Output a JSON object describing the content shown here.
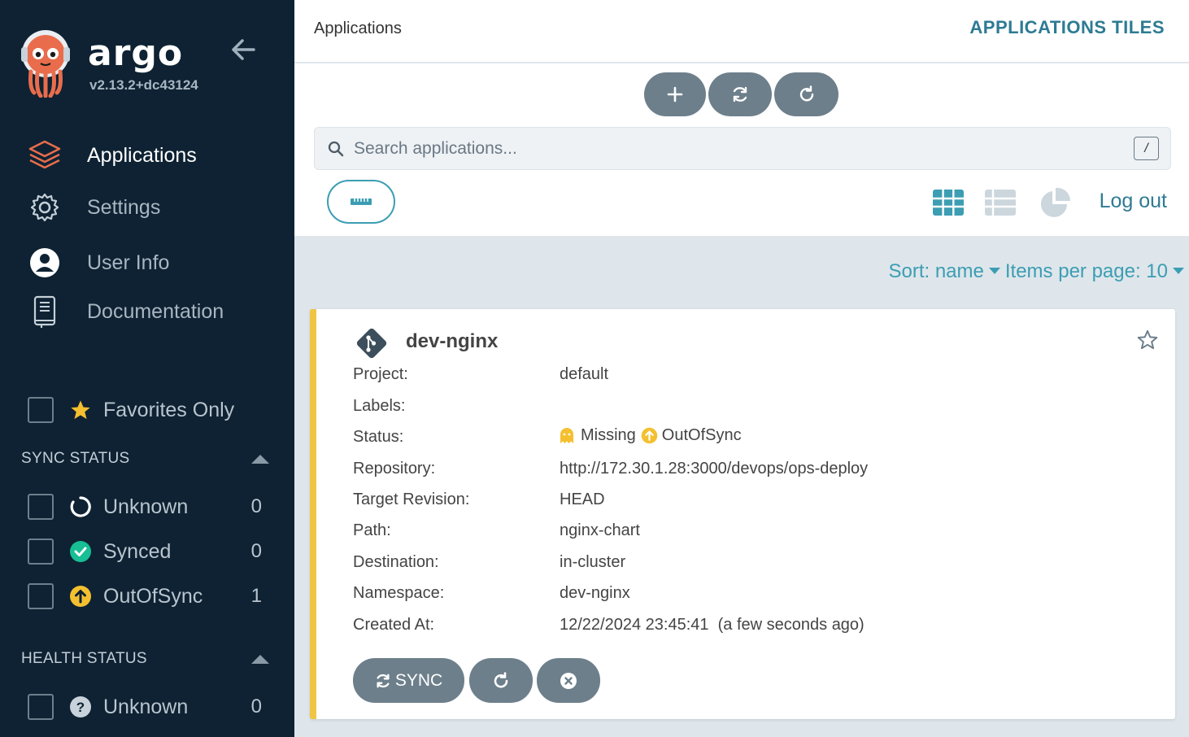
{
  "sidebar": {
    "brand": "argo",
    "version": "v2.13.2+dc43124",
    "nav": [
      {
        "label": "Applications",
        "icon": "stack-icon",
        "active": true
      },
      {
        "label": "Settings",
        "icon": "gear-icon"
      },
      {
        "label": "User Info",
        "icon": "user-icon"
      },
      {
        "label": "Documentation",
        "icon": "book-icon"
      }
    ],
    "favorites_label": "Favorites Only",
    "sync_status": {
      "title": "SYNC STATUS",
      "items": [
        {
          "label": "Unknown",
          "count": "0"
        },
        {
          "label": "Synced",
          "count": "0"
        },
        {
          "label": "OutOfSync",
          "count": "1"
        }
      ]
    },
    "health_status": {
      "title": "HEALTH STATUS",
      "items": [
        {
          "label": "Unknown",
          "count": "0"
        }
      ]
    }
  },
  "header": {
    "title": "Applications",
    "subtitle": "APPLICATIONS TILES"
  },
  "toolbar": {
    "search_placeholder": "Search applications...",
    "search_shortcut": "/",
    "logout_label": "Log out"
  },
  "sorting": {
    "sort_label": "Sort: name",
    "per_page_label": "Items per page: 10"
  },
  "app": {
    "name": "dev-nginx",
    "fields": [
      {
        "label": "Project:",
        "value": "default"
      },
      {
        "label": "Labels:",
        "value": ""
      },
      {
        "label": "Status:",
        "health": "Missing",
        "sync": "OutOfSync"
      },
      {
        "label": "Repository:",
        "value": "http://172.30.1.28:3000/devops/ops-deploy"
      },
      {
        "label": "Target Revision:",
        "value": "HEAD"
      },
      {
        "label": "Path:",
        "value": "nginx-chart"
      },
      {
        "label": "Destination:",
        "value": "in-cluster"
      },
      {
        "label": "Namespace:",
        "value": "dev-nginx"
      },
      {
        "label": "Created At:",
        "value": "12/22/2024 23:45:41  (a few seconds ago)"
      }
    ],
    "sync_button": "SYNC"
  },
  "colors": {
    "sidebar_bg": "#0e2233",
    "accent": "#3c9db3",
    "outofsync": "#f4c030",
    "synced": "#18be94",
    "button": "#6d7f8b"
  }
}
